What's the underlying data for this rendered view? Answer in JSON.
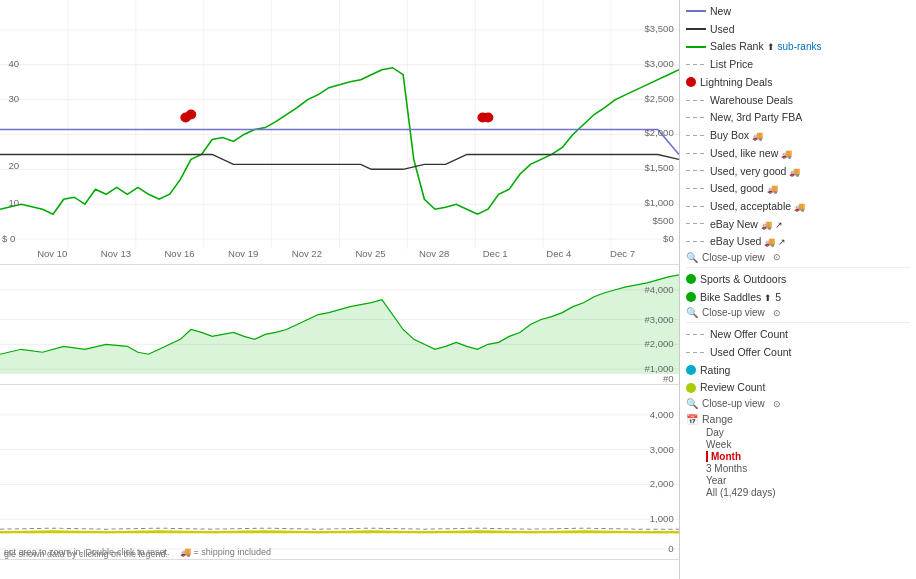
{
  "legend": {
    "items": [
      {
        "id": "new",
        "label": "New",
        "type": "line",
        "color": "#7070d0",
        "dashed": false
      },
      {
        "id": "used",
        "label": "Used",
        "type": "line",
        "color": "#333333",
        "dashed": false
      },
      {
        "id": "sales-rank",
        "label": "Sales Rank",
        "type": "line",
        "color": "#00aa00",
        "dashed": false,
        "extra": "sub-ranks"
      },
      {
        "id": "list-price",
        "label": "List Price",
        "type": "line",
        "color": "#aaaaaa",
        "dashed": true
      },
      {
        "id": "lightning-deals",
        "label": "Lightning Deals",
        "type": "dot",
        "color": "#cc0000"
      },
      {
        "id": "warehouse-deals",
        "label": "Warehouse Deals",
        "type": "line",
        "color": "#aaaaaa",
        "dashed": true
      },
      {
        "id": "new-3p-fba",
        "label": "New, 3rd Party FBA",
        "type": "line",
        "color": "#aaaaaa",
        "dashed": true
      },
      {
        "id": "buy-box",
        "label": "Buy Box",
        "type": "line",
        "color": "#aaaaaa",
        "dashed": true,
        "hasTruck": true
      },
      {
        "id": "used-like-new",
        "label": "Used, like new",
        "type": "line",
        "color": "#aaaaaa",
        "dashed": true,
        "hasTruck": true
      },
      {
        "id": "used-very-good",
        "label": "Used, very good",
        "type": "line",
        "color": "#aaaaaa",
        "dashed": true,
        "hasTruck": true
      },
      {
        "id": "used-good",
        "label": "Used, good",
        "type": "line",
        "color": "#aaaaaa",
        "dashed": true,
        "hasTruck": true
      },
      {
        "id": "used-acceptable",
        "label": "Used, acceptable",
        "type": "line",
        "color": "#aaaaaa",
        "dashed": true,
        "hasTruck": true
      },
      {
        "id": "ebay-new",
        "label": "eBay New",
        "type": "line",
        "color": "#aaaaaa",
        "dashed": true,
        "hasExternal": true
      },
      {
        "id": "ebay-used",
        "label": "eBay Used",
        "type": "line",
        "color": "#aaaaaa",
        "dashed": true,
        "hasExternal": true
      }
    ],
    "close_up_1": "Close-up view",
    "categories": [
      {
        "label": "Sports & Outdoors",
        "color": "#00aa00"
      },
      {
        "label": "Bike Saddles",
        "color": "#00aa00",
        "extra": "5"
      }
    ],
    "close_up_2": "Close-up view",
    "offer_items": [
      {
        "id": "new-offer-count",
        "label": "New Offer Count",
        "type": "line",
        "color": "#aaaaaa",
        "dashed": true
      },
      {
        "id": "used-offer-count",
        "label": "Used Offer Count",
        "type": "line",
        "color": "#aaaaaa",
        "dashed": true
      },
      {
        "id": "rating",
        "label": "Rating",
        "type": "dot",
        "color": "#00aacc"
      },
      {
        "id": "review-count",
        "label": "Review Count",
        "type": "dot",
        "color": "#aacc00"
      }
    ],
    "close_up_3": "Close-up view",
    "range_label": "Range",
    "range_options": [
      {
        "label": "Day",
        "active": false
      },
      {
        "label": "Week",
        "active": false
      },
      {
        "label": "Month",
        "active": true
      },
      {
        "label": "3 Months",
        "active": false
      },
      {
        "label": "Year",
        "active": false
      },
      {
        "label": "All (1,429 days)",
        "active": false
      }
    ]
  },
  "xaxis_top": [
    "Nov 10",
    "Nov 13",
    "Nov 16",
    "Nov 19",
    "Nov 22",
    "Nov 25",
    "Nov 28",
    "Dec 1",
    "Dec 4",
    "Dec 7"
  ],
  "yaxis_top": [
    "$3,500",
    "$3,000",
    "$2,500",
    "$2,000",
    "$1,500",
    "$1,000",
    "$500",
    "$0"
  ],
  "yaxis_mid": [
    "#4,000",
    "#3,000",
    "#2,000",
    "#1,000",
    "#0"
  ],
  "yaxis_bot": [
    "4,000",
    "3,000",
    "2,000",
    "1,000",
    "0"
  ],
  "bottom_note_1": "ect area to zoom in. Double-click to reset.",
  "bottom_note_2": "= shipping included",
  "bottom_note_3": "gle shown data by clicking on the legend.",
  "top_yaxis_vals": [
    "40",
    "30",
    "20",
    "10",
    "$ 0"
  ]
}
